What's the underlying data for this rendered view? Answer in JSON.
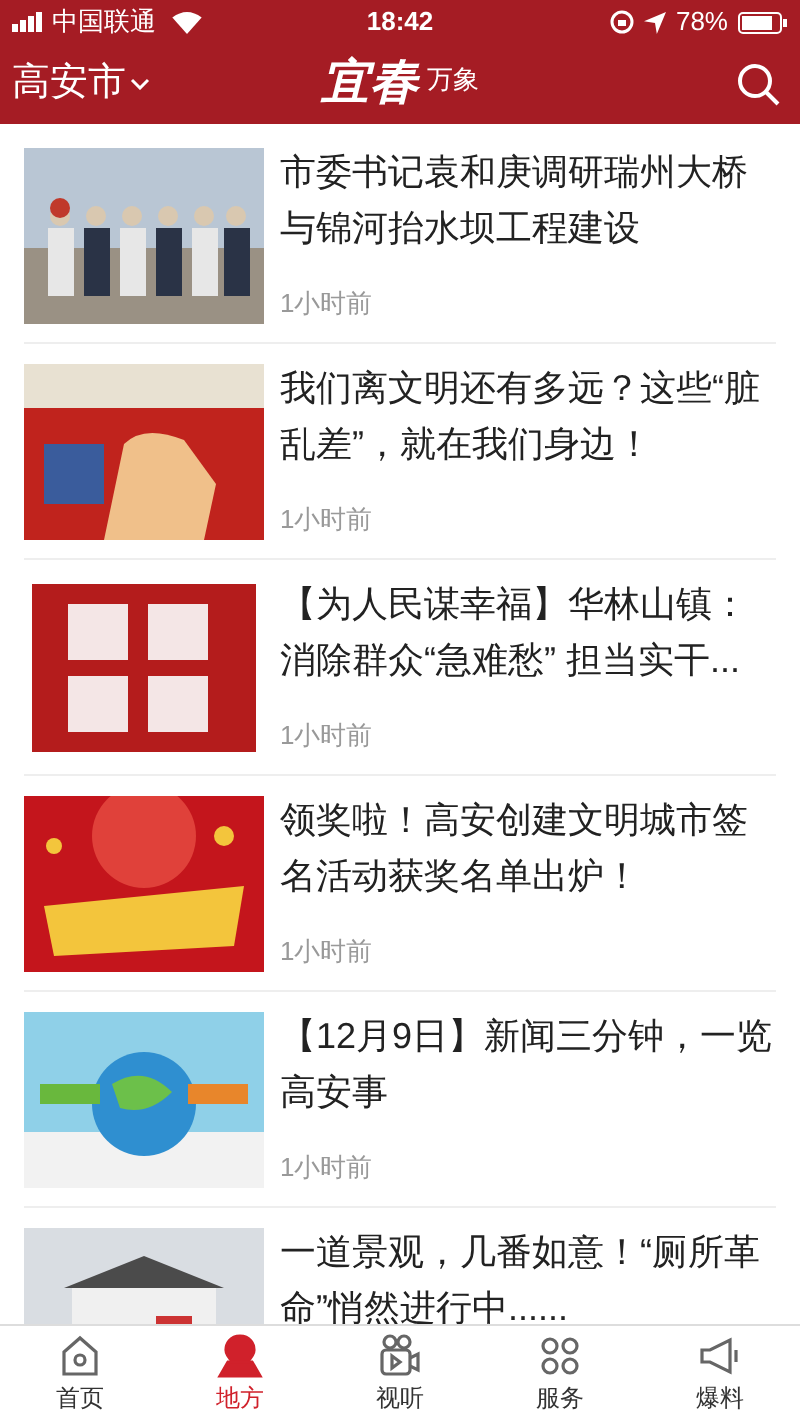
{
  "status_bar": {
    "carrier": "中国联通",
    "time": "18:42",
    "battery": "78%"
  },
  "header": {
    "city": "高安市",
    "logo_main": "宜春",
    "logo_side": "万象"
  },
  "articles": [
    {
      "title": "市委书记袁和庚调研瑞州大桥与锦河抬水坝工程建设",
      "time": "1小时前",
      "kind": "picture"
    },
    {
      "title": "我们离文明还有多远？这些“脏乱差”，就在我们身边！",
      "time": "1小时前",
      "kind": "picture"
    },
    {
      "title": "【为人民谋幸福】华林山镇：消除群众“急难愁” 担当实干...",
      "time": "1小时前",
      "kind": "picture"
    },
    {
      "title": "领奖啦！高安创建文明城市签名活动获奖名单出炉！",
      "time": "1小时前",
      "kind": "picture"
    },
    {
      "title": "【12月9日】新闻三分钟，一览高安事",
      "time": "1小时前",
      "kind": "picture"
    },
    {
      "title": "一道景观，几番如意！“厕所革命”悄然进行中......",
      "kind": "picture"
    }
  ],
  "tab_bar": [
    {
      "label": "首页",
      "selected": false
    },
    {
      "label": "地方",
      "selected": true
    },
    {
      "label": "视听",
      "selected": false
    },
    {
      "label": "服务",
      "selected": false
    },
    {
      "label": "爆料",
      "selected": false
    }
  ]
}
